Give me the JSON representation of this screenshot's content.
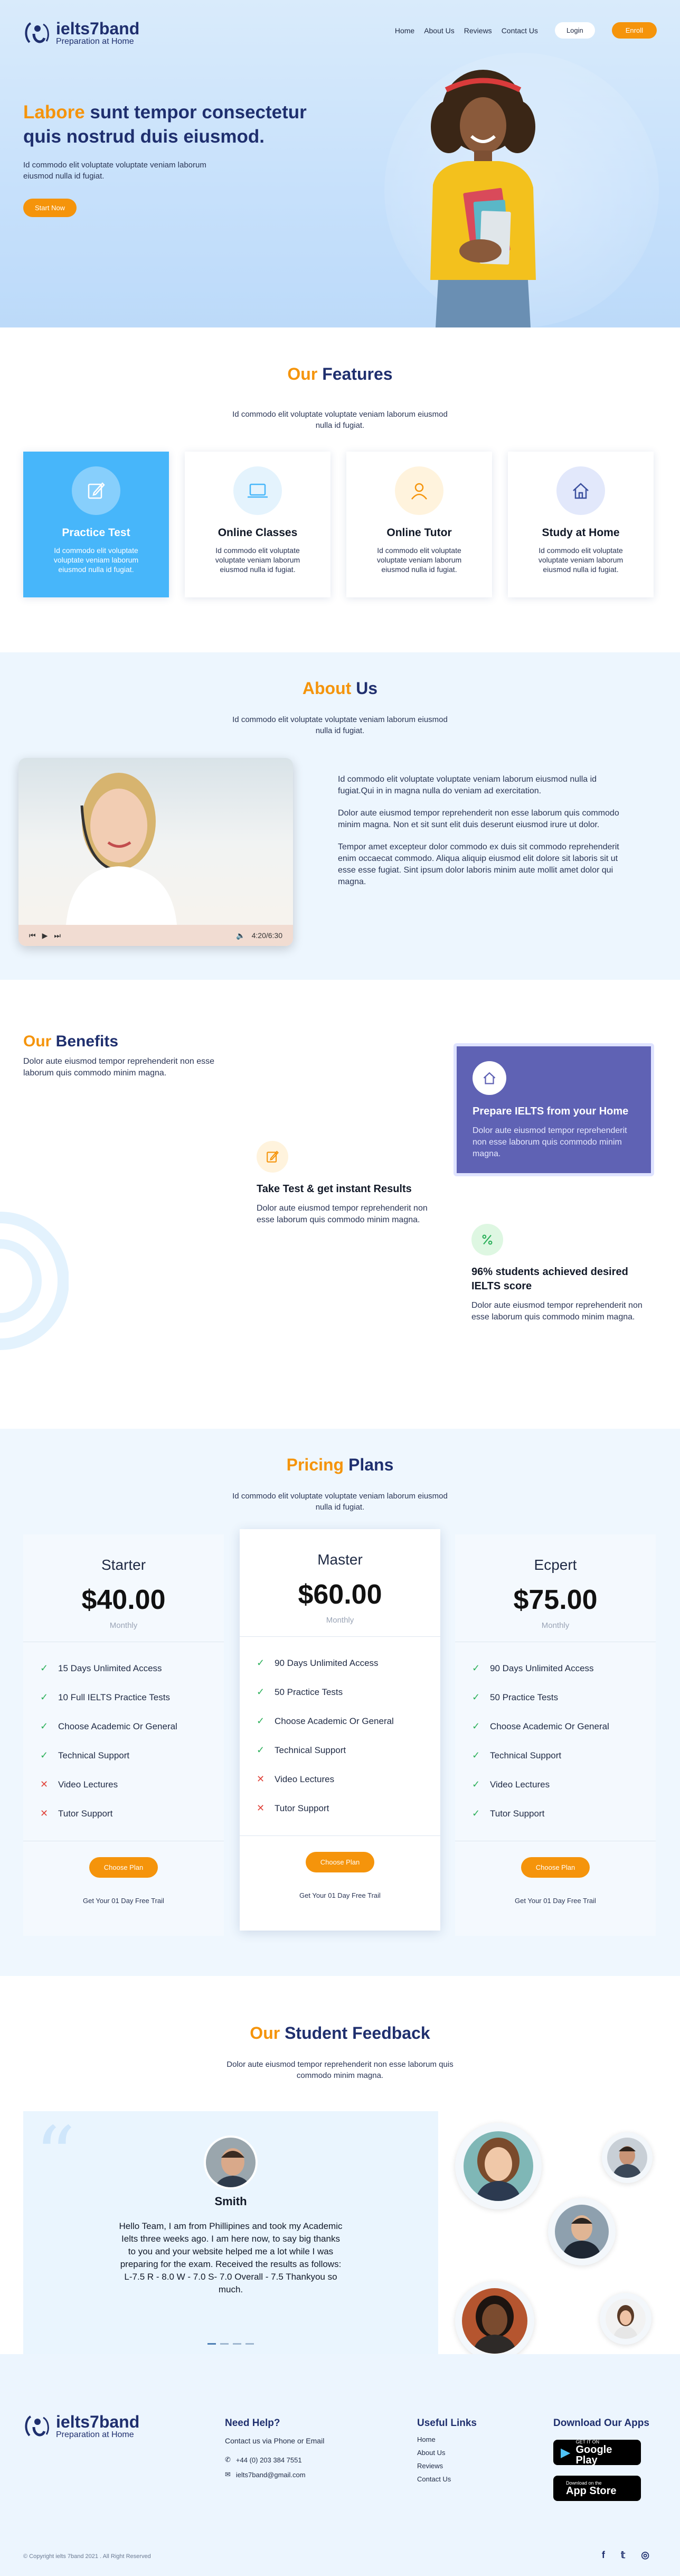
{
  "brand": {
    "name": "ielts7band",
    "tagline": "Preparation at Home"
  },
  "nav": {
    "items": [
      "Home",
      "About Us",
      "Reviews",
      "Contact Us"
    ],
    "login": "Login",
    "enroll": "Enroll"
  },
  "hero": {
    "title_highlight": "Labore",
    "title_rest": " sunt tempor consectetur quis nostrud duis eiusmod.",
    "subtitle": "Id commodo elit voluptate voluptate veniam laborum eiusmod nulla id fugiat.",
    "cta": "Start Now"
  },
  "features": {
    "title_a": "Our",
    "title_b": " Features",
    "subtitle": "Id commodo elit voluptate voluptate veniam laborum eiusmod nulla id fugiat.",
    "items": [
      {
        "title": "Practice Test",
        "desc": "Id commodo elit voluptate voluptate veniam laborum eiusmod nulla id fugiat."
      },
      {
        "title": "Online Classes",
        "desc": "Id commodo elit voluptate voluptate veniam laborum eiusmod nulla id fugiat."
      },
      {
        "title": "Online Tutor",
        "desc": "Id commodo elit voluptate voluptate veniam laborum eiusmod nulla id fugiat."
      },
      {
        "title": "Study at Home",
        "desc": "Id commodo elit voluptate voluptate veniam laborum eiusmod nulla id fugiat."
      }
    ]
  },
  "about": {
    "title_a": "About",
    "title_b": " Us",
    "subtitle": "Id commodo elit voluptate voluptate veniam laborum eiusmod nulla id fugiat.",
    "video_time": "4:20/6:30",
    "paragraphs": [
      "Id commodo elit voluptate voluptate veniam laborum eiusmod nulla id fugiat.Qui in in magna nulla do veniam ad exercitation.",
      "Dolor aute eiusmod tempor reprehenderit non esse laborum quis commodo minim magna. Non et sit sunt elit duis deserunt eiusmod irure ut dolor.",
      "Tempor amet excepteur dolor commodo ex duis sit commodo reprehenderit enim occaecat commodo. Aliqua aliquip eiusmod elit dolore sit laboris sit ut esse esse fugiat. Sint ipsum dolor laboris minim aute mollit amet dolor qui magna."
    ]
  },
  "benefits": {
    "title_a": "Our",
    "title_b": " Benefits",
    "desc": "Dolor aute eiusmod tempor reprehenderit non esse laborum quis commodo minim magna.",
    "items": [
      {
        "title": "Prepare IELTS from your Home",
        "desc": "Dolor aute eiusmod tempor reprehenderit non esse laborum quis commodo minim magna."
      },
      {
        "title": "Take Test & get instant Results",
        "desc": "Dolor aute eiusmod tempor reprehenderit non esse laborum quis commodo minim magna."
      },
      {
        "title": "96% students achieved desired IELTS score",
        "desc": "Dolor aute eiusmod tempor reprehenderit non esse laborum quis commodo minim magna."
      }
    ]
  },
  "pricing": {
    "title_a": "Pricing",
    "title_b": " Plans",
    "subtitle": "Id commodo elit voluptate voluptate veniam laborum eiusmod nulla id fugiat.",
    "plans": [
      {
        "name": "Starter",
        "price": "$40.00",
        "period": "Monthly",
        "button": "Choose Plan",
        "trial": "Get Your 01 Day Free Trail",
        "features": [
          {
            "text": "15 Days Unlimited Access",
            "included": true
          },
          {
            "text": "10 Full IELTS Practice Tests",
            "included": true
          },
          {
            "text": "Choose Academic Or General",
            "included": true
          },
          {
            "text": "Technical Support",
            "included": true
          },
          {
            "text": "Video Lectures",
            "included": false
          },
          {
            "text": "Tutor Support",
            "included": false
          }
        ]
      },
      {
        "name": "Master",
        "price": "$60.00",
        "period": "Monthly",
        "button": "Choose Plan",
        "trial": "Get Your 01 Day Free Trail",
        "features": [
          {
            "text": "90 Days Unlimited Access",
            "included": true
          },
          {
            "text": "50 Practice Tests",
            "included": true
          },
          {
            "text": "Choose Academic Or General",
            "included": true
          },
          {
            "text": "Technical Support",
            "included": true
          },
          {
            "text": "Video Lectures",
            "included": false
          },
          {
            "text": "Tutor Support",
            "included": false
          }
        ]
      },
      {
        "name": "Ecpert",
        "price": "$75.00",
        "period": "Monthly",
        "button": "Choose Plan",
        "trial": "Get Your 01 Day Free Trail",
        "features": [
          {
            "text": "90 Days Unlimited Access",
            "included": true
          },
          {
            "text": "50 Practice Tests",
            "included": true
          },
          {
            "text": "Choose Academic Or General",
            "included": true
          },
          {
            "text": "Technical Support",
            "included": true
          },
          {
            "text": "Video Lectures",
            "included": true
          },
          {
            "text": "Tutor Support",
            "included": true
          }
        ]
      }
    ]
  },
  "feedback": {
    "title_a": "Our",
    "title_b": " Student Feedback",
    "subtitle": "Dolor aute eiusmod tempor reprehenderit non esse laborum quis commodo minim magna.",
    "name": "Smith",
    "text": "Hello Team, I am from Phillipines and took my Academic Ielts three weeks ago. I am here now, to say big thanks to you and your website helped me a lot while I was preparing for the exam. Received the results as follows: L-7.5 R - 8.0 W - 7.0 S- 7.0 Overall - 7.5 Thankyou so much."
  },
  "footer": {
    "help_title": "Need Help?",
    "help_line": "Contact us via Phone or Email",
    "phone": "+44 (0) 203 384 7551",
    "email": "ielts7band@gmail.com",
    "links_title": "Useful Links",
    "links": [
      "Home",
      "About Us",
      "Reviews",
      "Contact Us"
    ],
    "apps_title": "Download Our Apps",
    "google_small": "GET IT ON",
    "google_big": "Google Play",
    "apple_small": "Download on the",
    "apple_big": "App Store",
    "copyright": "© Copyright ielts 7band 2021 . All Right Reserved",
    "social": [
      "f",
      "t",
      "ig"
    ]
  },
  "colors": {
    "orange": "#f5940b",
    "navy": "#1f2f6e",
    "sky": "#47b6fa",
    "purple": "#5f62b4",
    "check": "#2bb05a",
    "cross": "#e0433a"
  }
}
